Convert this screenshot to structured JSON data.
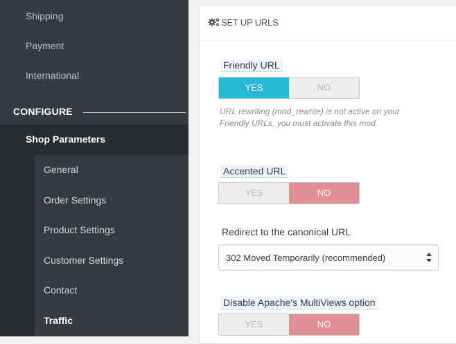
{
  "sidebar": {
    "top_items": [
      {
        "label": "Shipping"
      },
      {
        "label": "Payment"
      },
      {
        "label": "International"
      }
    ],
    "section_header": "CONFIGURE",
    "active_parent": "Shop Parameters",
    "sub_items": [
      {
        "label": "General"
      },
      {
        "label": "Order Settings"
      },
      {
        "label": "Product Settings"
      },
      {
        "label": "Customer Settings"
      },
      {
        "label": "Contact"
      },
      {
        "label": "Traffic"
      }
    ]
  },
  "panel": {
    "title": "SET UP URLS",
    "friendly_url": {
      "label": "Friendly URL",
      "yes": "YES",
      "no": "NO",
      "selected": "YES",
      "help_line1": "URL rewriting (mod_rewrite) is not active on your",
      "help_line2": "Friendly URLs, you must activate this mod."
    },
    "accented_url": {
      "label": "Accented URL",
      "yes": "YES",
      "no": "NO",
      "selected": "NO"
    },
    "canonical": {
      "label": "Redirect to the canonical URL",
      "value": "302 Moved Temporarily (recommended)"
    },
    "multiviews": {
      "label": "Disable Apache's MultiViews option",
      "yes": "YES",
      "no": "NO",
      "selected": "NO"
    }
  },
  "colors": {
    "sidebar_bg": "#363a41",
    "active_bg": "#282b30",
    "yes_on": "#25b9d7",
    "no_on": "#e08f95"
  },
  "icons": {
    "panel_title_icon": "gears-icon",
    "select_arrows": "updown-arrows-icon"
  }
}
